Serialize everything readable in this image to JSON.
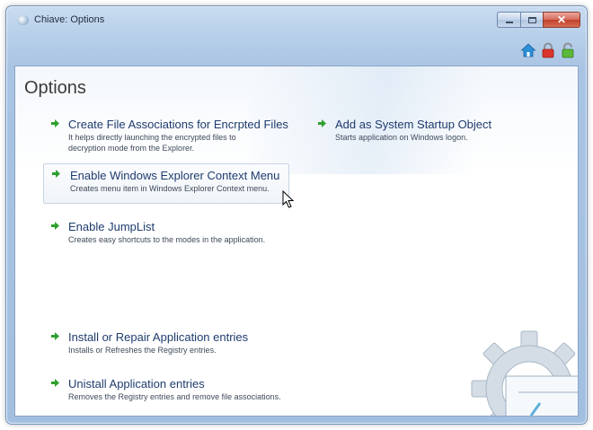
{
  "window": {
    "title": "Chiave: Options"
  },
  "toolbar": {
    "icons": [
      "home-icon",
      "lock-icon",
      "unlock-icon"
    ]
  },
  "content": {
    "heading": "Options",
    "options": [
      {
        "title": "Create File Associations for Encrpted Files",
        "description_line1": "It helps directly launching the encrypted files to",
        "description_line2": "decryption mode from the Explorer."
      },
      {
        "title": "Add as System Startup Object",
        "description_line1": "Starts application on Windows logon."
      },
      {
        "title": "Enable Windows Explorer Context Menu",
        "description_line1": "Creates menu item in Windows Explorer Context menu."
      },
      {
        "title": "Enable JumpList",
        "description_line1": "Creates easy shortcuts to the modes in the application."
      },
      {
        "title": "Install or Repair Application entries",
        "description_line1": "Installs or Refreshes the Registry entries."
      },
      {
        "title": "Unistall Application entries",
        "description_line1": "Removes the Registry entries and remove file associations."
      }
    ]
  },
  "colors": {
    "link": "#1f3c6e",
    "arrow": "#2ea02e",
    "frame": "#a9c4e3"
  }
}
